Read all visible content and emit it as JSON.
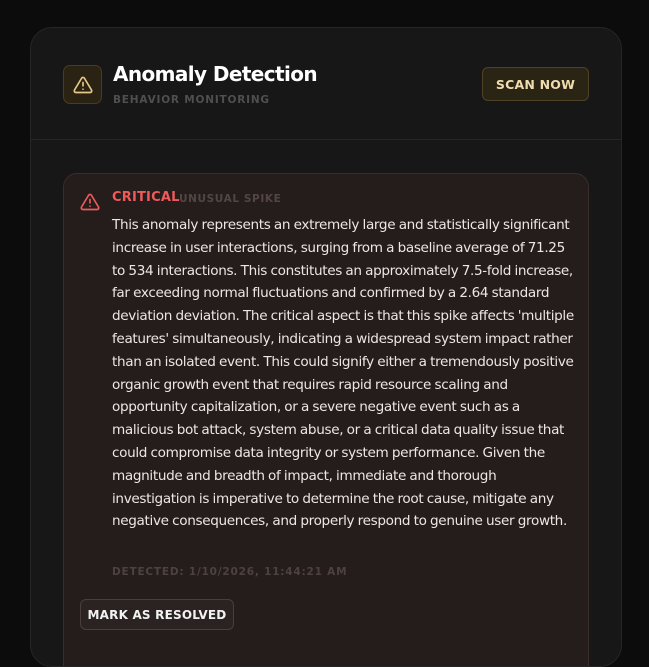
{
  "header": {
    "title": "Anomaly Detection",
    "subtitle": "BEHAVIOR MONITORING",
    "icon": "warning-triangle-icon",
    "scan_button": "SCAN NOW"
  },
  "alert": {
    "icon": "warning-triangle-icon",
    "severity": "CRITICAL",
    "type": "UNUSUAL SPIKE",
    "description": "This anomaly represents an extremely large and statistically significant increase in user interactions, surging from a baseline average of 71.25 to 534 interactions. This constitutes an approximately 7.5-fold increase, far exceeding normal fluctuations and confirmed by a 2.64 standard deviation deviation. The critical aspect is that this spike affects 'multiple features' simultaneously, indicating a widespread system impact rather than an isolated event. This could signify either a tremendously positive organic growth event that requires rapid resource scaling and opportunity capitalization, or a severe negative event such as a malicious bot attack, system abuse, or a critical data quality issue that could compromise data integrity or system performance. Given the magnitude and breadth of impact, immediate and thorough investigation is imperative to determine the root cause, mitigate any negative consequences, and properly respond to genuine user growth.",
    "detected": "DETECTED: 1/10/2026, 11:44:21 AM",
    "resolve_button": "MARK AS RESOLVED"
  },
  "colors": {
    "background": "#0c0c0c",
    "panel": "#171717",
    "accent": "#f0dcae",
    "critical": "#ef5a5a",
    "alert_card": "#241d1c"
  }
}
